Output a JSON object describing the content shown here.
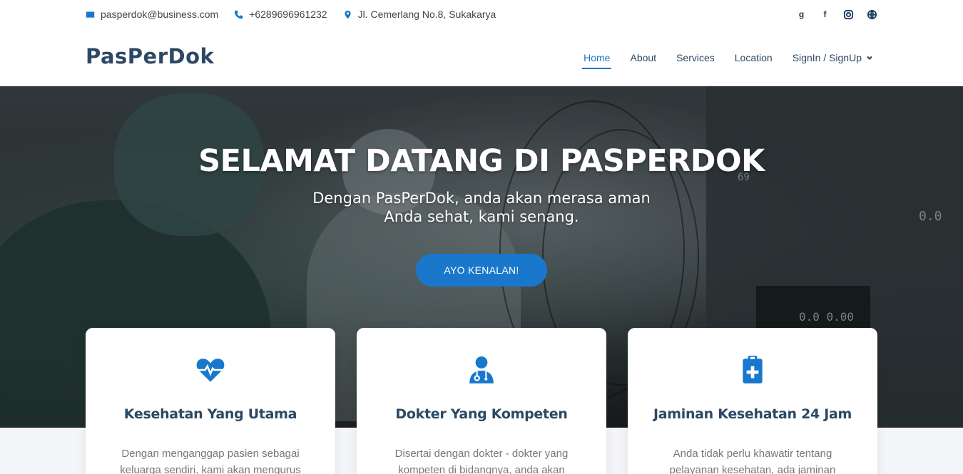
{
  "topbar": {
    "email": "pasperdok@business.com",
    "phone": "+6289696961232",
    "address": "Jl. Cemerlang No.8, Sukakarya",
    "social": [
      "google-icon",
      "facebook-icon",
      "instagram-icon",
      "globe-icon"
    ]
  },
  "header": {
    "logo": "PasPerDok",
    "nav": [
      {
        "label": "Home",
        "active": true
      },
      {
        "label": "About"
      },
      {
        "label": "Services"
      },
      {
        "label": "Location"
      },
      {
        "label": "SignIn / SignUp",
        "dropdown": true
      }
    ]
  },
  "hero": {
    "title": "SELAMAT DATANG DI PASPERDOK",
    "subtitle_line1": "Dengan PasPerDok, anda akan merasa aman",
    "subtitle_line2": "Anda sehat, kami senang.",
    "cta": "AYO KENALAN!",
    "monitor_readouts": [
      "0.0 0.00",
      "0.0",
      "69"
    ]
  },
  "cards": [
    {
      "icon": "heart-pulse-icon",
      "title": "Kesehatan Yang Utama",
      "text": "Dengan menganggap pasien sebagai keluarga sendiri, kami akan mengurus"
    },
    {
      "icon": "doctor-icon",
      "title": "Dokter Yang Kompeten",
      "text": "Disertai dengan dokter - dokter yang kompeten di bidangnya, anda akan"
    },
    {
      "icon": "medical-clipboard-icon",
      "title": "Jaminan Kesehatan 24 Jam",
      "text": "Anda tidak perlu khawatir tentang pelayanan kesehatan, ada jaminan"
    }
  ],
  "colors": {
    "accent": "#1977cc",
    "heading": "#2c4964"
  }
}
